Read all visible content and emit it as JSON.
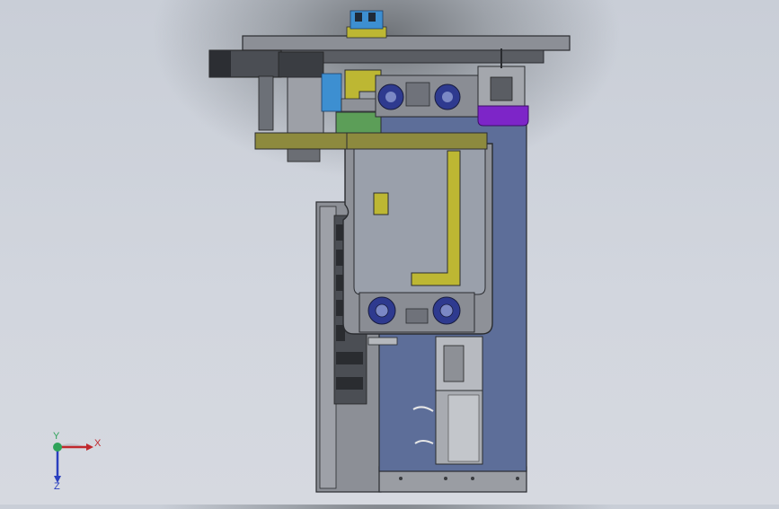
{
  "view": {
    "triad": {
      "x_label": "X",
      "y_label": "Y",
      "z_label": "Z"
    }
  },
  "colors": {
    "body_blue": "#5d6e99",
    "plate_gray": "#8c8f96",
    "dark_gray": "#3c3f44",
    "yellow_bracket": "#bdb733",
    "olive_plate": "#8d8a3e",
    "purple_block": "#7d25c8",
    "green_block": "#5c9e58",
    "cyan_block": "#3d8fd1",
    "axis_x": "#c0282d",
    "axis_y": "#2fa35a",
    "axis_z": "#2a3fbf"
  }
}
